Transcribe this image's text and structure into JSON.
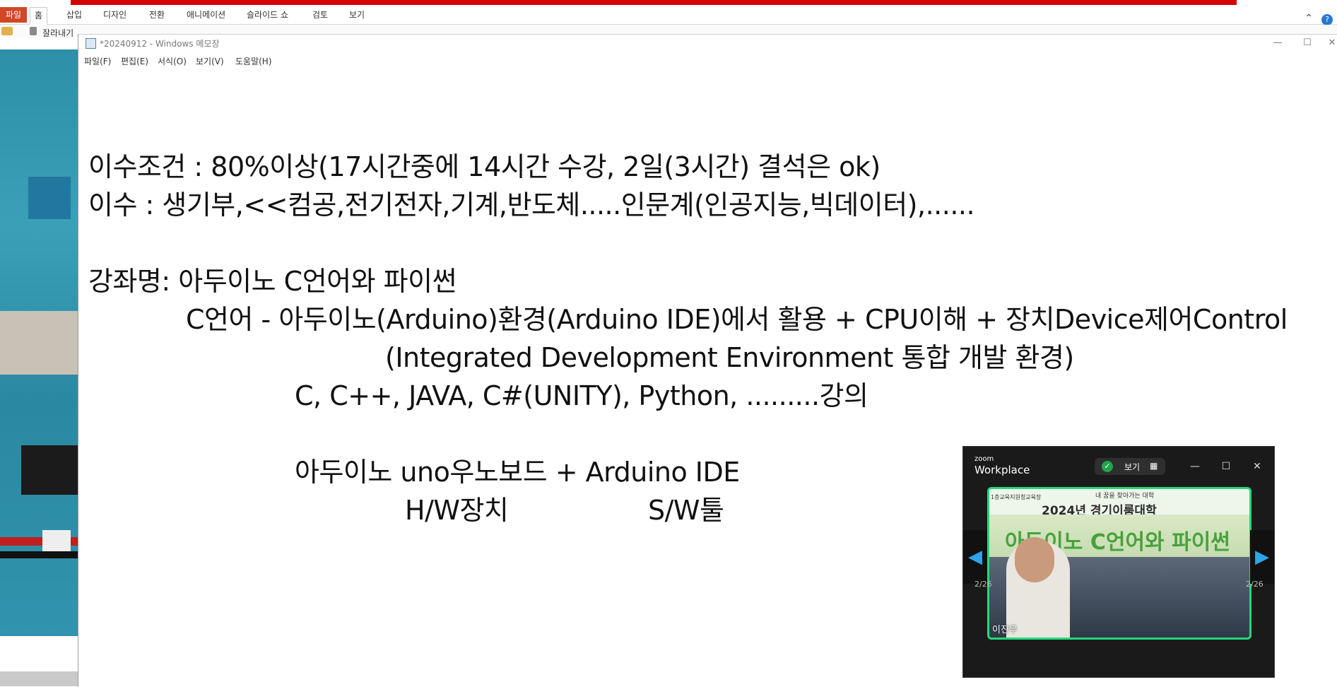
{
  "powerpoint": {
    "ribbon_tabs": [
      "파일",
      "홈",
      "삽입",
      "디자인",
      "전환",
      "애니메이션",
      "슬라이드 쇼",
      "검토",
      "보기"
    ],
    "cut_label": "잘라내기",
    "help_icon_glyph": "?",
    "collapse_icon_glyph": "⌃"
  },
  "notepad": {
    "title": "*20240912 - Windows 메모장",
    "menu": [
      "파일(F)",
      "편집(E)",
      "서식(O)",
      "보기(V)",
      "도움말(H)"
    ],
    "window_buttons": {
      "minimize": "—",
      "maximize": "☐",
      "close": "✕"
    },
    "lines": [
      "이수조건 : 80%이상(17시간중에 14시간 수강, 2일(3시간) 결석은 ok)",
      "이수 : 생기부,<<컴공,전기전자,기계,반도체.....인문계(인공지능,빅데이터),......",
      "강좌명: 아두이노 C언어와 파이썬",
      "C언어 - 아두이노(Arduino)환경(Arduino IDE)에서 활용 + CPU이해 + 장치Device제어Control",
      "(Integrated Development Environment 통합 개발 환경)",
      "C, C++, JAVA, C#(UNITY), Python, .........강의",
      "아두이노 uno우노보드 + Arduino IDE",
      "H/W장치",
      "S/W툴"
    ]
  },
  "zoom": {
    "brand_small": "zoom",
    "brand": "Workplace",
    "view_label": "보기",
    "shield_icon_glyph": "✓",
    "grid_icon_glyph": "▦",
    "window_buttons": {
      "minimize": "—",
      "maximize": "☐",
      "close": "✕"
    },
    "banner_left": "1층교육지원청교육장",
    "banner_subtitle": "내 꿈을 찾아가는 대학",
    "banner_title": "2024년 경기이룸대학",
    "banner_course": "아두이노 C언어와 파이썬",
    "participant_name": "이진우",
    "page_left": "2/26",
    "page_right": "2/26",
    "arrow_left": "◀",
    "arrow_right": "▶",
    "accent_color": "#23d97b"
  }
}
